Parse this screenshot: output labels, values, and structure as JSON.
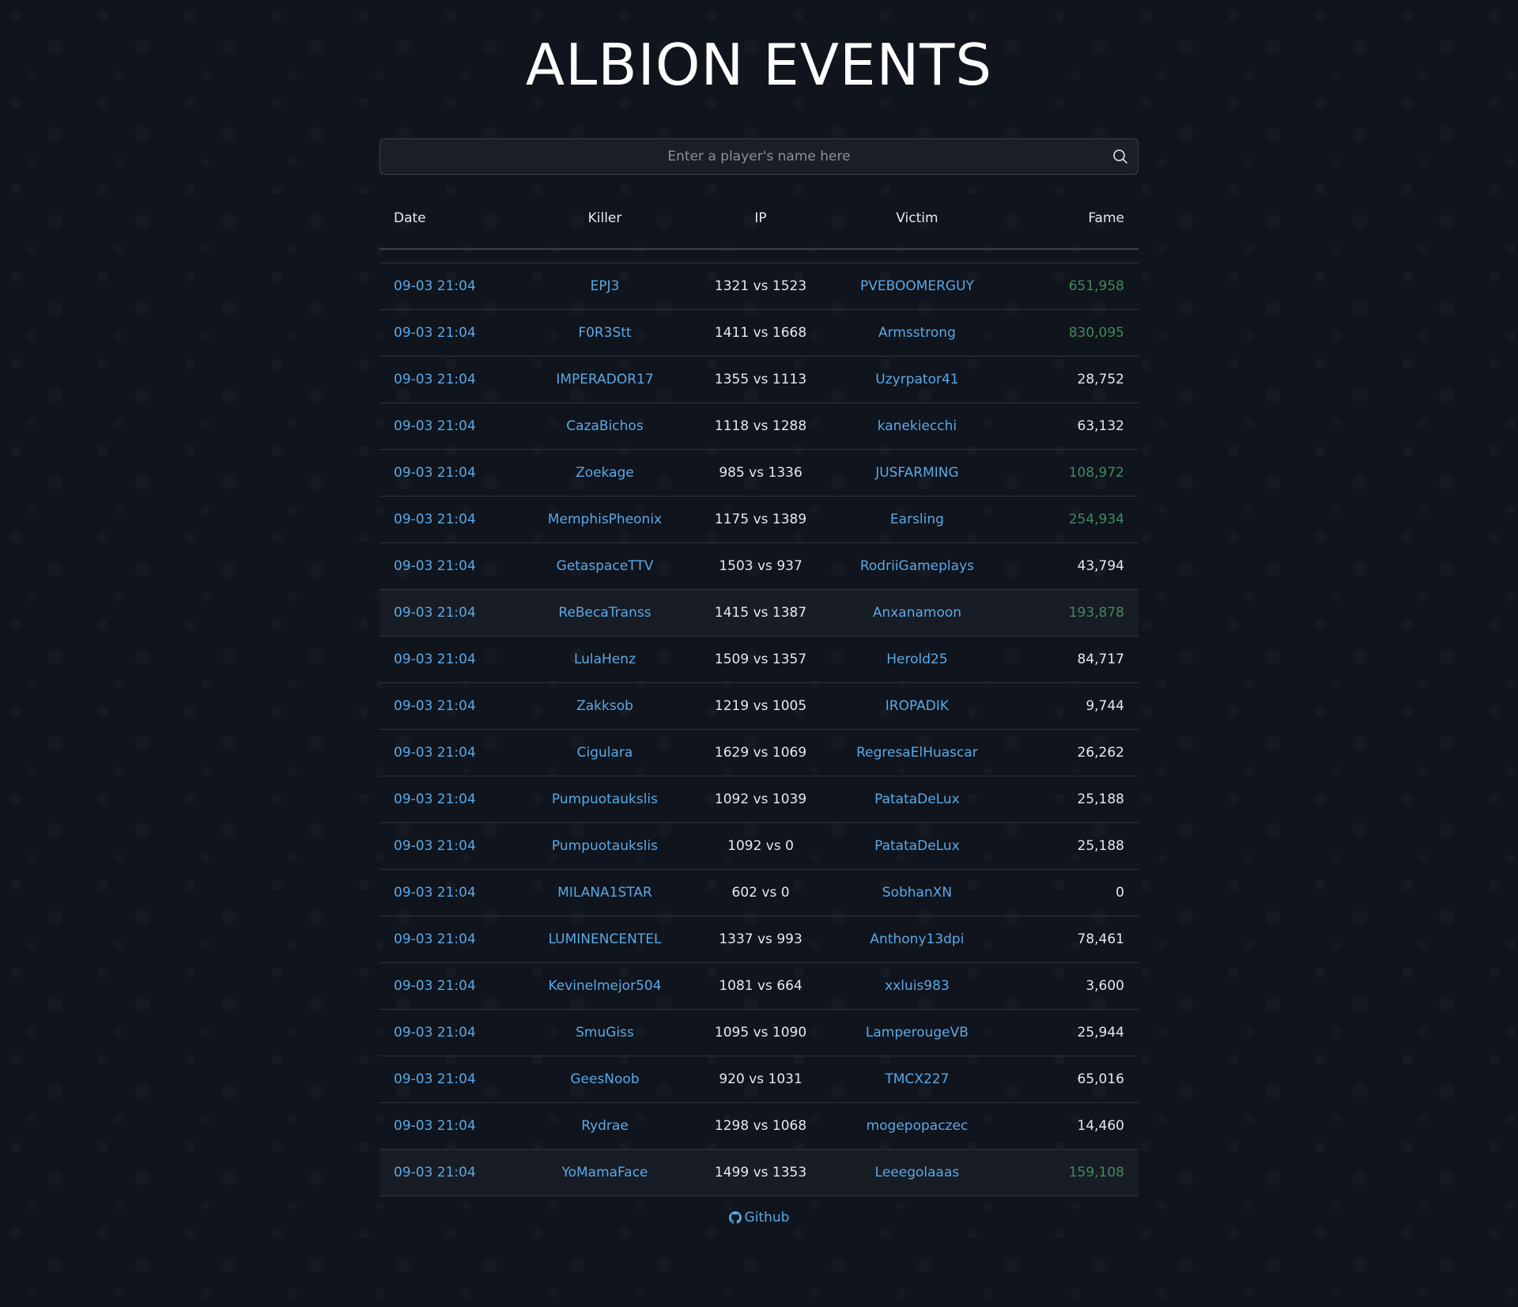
{
  "page": {
    "title": "ALBION EVENTS"
  },
  "search": {
    "placeholder": "Enter a player's name here",
    "value": ""
  },
  "table": {
    "headers": {
      "date": "Date",
      "killer": "Killer",
      "ip": "IP",
      "victim": "Victim",
      "fame": "Fame"
    },
    "rows": [
      {
        "date": "09-03 21:04",
        "killer": "EPJ3",
        "ip": "1321 vs 1523",
        "victim": "PVEBOOMERGUY",
        "fame": "651,958",
        "fame_highlight": true,
        "row_highlight": false
      },
      {
        "date": "09-03 21:04",
        "killer": "F0R3Stt",
        "ip": "1411 vs 1668",
        "victim": "Armsstrong",
        "fame": "830,095",
        "fame_highlight": true,
        "row_highlight": false
      },
      {
        "date": "09-03 21:04",
        "killer": "IMPERADOR17",
        "ip": "1355 vs 1113",
        "victim": "Uzyrpator41",
        "fame": "28,752",
        "fame_highlight": false,
        "row_highlight": false
      },
      {
        "date": "09-03 21:04",
        "killer": "CazaBichos",
        "ip": "1118 vs 1288",
        "victim": "kanekiecchi",
        "fame": "63,132",
        "fame_highlight": false,
        "row_highlight": false
      },
      {
        "date": "09-03 21:04",
        "killer": "Zoekage",
        "ip": "985 vs 1336",
        "victim": "JUSFARMING",
        "fame": "108,972",
        "fame_highlight": true,
        "row_highlight": false
      },
      {
        "date": "09-03 21:04",
        "killer": "MemphisPheonix",
        "ip": "1175 vs 1389",
        "victim": "Earsling",
        "fame": "254,934",
        "fame_highlight": true,
        "row_highlight": false
      },
      {
        "date": "09-03 21:04",
        "killer": "GetaspaceTTV",
        "ip": "1503 vs 937",
        "victim": "RodriiGameplays",
        "fame": "43,794",
        "fame_highlight": false,
        "row_highlight": false
      },
      {
        "date": "09-03 21:04",
        "killer": "ReBecaTranss",
        "ip": "1415 vs 1387",
        "victim": "Anxanamoon",
        "fame": "193,878",
        "fame_highlight": true,
        "row_highlight": true
      },
      {
        "date": "09-03 21:04",
        "killer": "LulaHenz",
        "ip": "1509 vs 1357",
        "victim": "Herold25",
        "fame": "84,717",
        "fame_highlight": false,
        "row_highlight": false
      },
      {
        "date": "09-03 21:04",
        "killer": "Zakksob",
        "ip": "1219 vs 1005",
        "victim": "IROPADIK",
        "fame": "9,744",
        "fame_highlight": false,
        "row_highlight": false
      },
      {
        "date": "09-03 21:04",
        "killer": "Cigulara",
        "ip": "1629 vs 1069",
        "victim": "RegresaElHuascar",
        "fame": "26,262",
        "fame_highlight": false,
        "row_highlight": false
      },
      {
        "date": "09-03 21:04",
        "killer": "Pumpuotaukslis",
        "ip": "1092 vs 1039",
        "victim": "PatataDeLux",
        "fame": "25,188",
        "fame_highlight": false,
        "row_highlight": false
      },
      {
        "date": "09-03 21:04",
        "killer": "Pumpuotaukslis",
        "ip": "1092 vs 0",
        "victim": "PatataDeLux",
        "fame": "25,188",
        "fame_highlight": false,
        "row_highlight": false
      },
      {
        "date": "09-03 21:04",
        "killer": "MILANA1STAR",
        "ip": "602 vs 0",
        "victim": "SobhanXN",
        "fame": "0",
        "fame_highlight": false,
        "row_highlight": false
      },
      {
        "date": "09-03 21:04",
        "killer": "LUMINENCENTEL",
        "ip": "1337 vs 993",
        "victim": "Anthony13dpi",
        "fame": "78,461",
        "fame_highlight": false,
        "row_highlight": false
      },
      {
        "date": "09-03 21:04",
        "killer": "Kevinelmejor504",
        "ip": "1081 vs 664",
        "victim": "xxluis983",
        "fame": "3,600",
        "fame_highlight": false,
        "row_highlight": false
      },
      {
        "date": "09-03 21:04",
        "killer": "SmuGiss",
        "ip": "1095 vs 1090",
        "victim": "LamperougeVB",
        "fame": "25,944",
        "fame_highlight": false,
        "row_highlight": false
      },
      {
        "date": "09-03 21:04",
        "killer": "GeesNoob",
        "ip": "920 vs 1031",
        "victim": "TMCX227",
        "fame": "65,016",
        "fame_highlight": false,
        "row_highlight": false
      },
      {
        "date": "09-03 21:04",
        "killer": "Rydrae",
        "ip": "1298 vs 1068",
        "victim": "mogepopaczec",
        "fame": "14,460",
        "fame_highlight": false,
        "row_highlight": false
      },
      {
        "date": "09-03 21:04",
        "killer": "YoMamaFace",
        "ip": "1499 vs 1353",
        "victim": "Leeegolaaas",
        "fame": "159,108",
        "fame_highlight": true,
        "row_highlight": true
      }
    ]
  },
  "footer": {
    "link_label": "Github",
    "icon": "github-icon"
  },
  "colors": {
    "background": "#10141d",
    "link": "#5aa9e6",
    "fame_high": "#3f8a5f",
    "text": "#e6e9ee"
  }
}
